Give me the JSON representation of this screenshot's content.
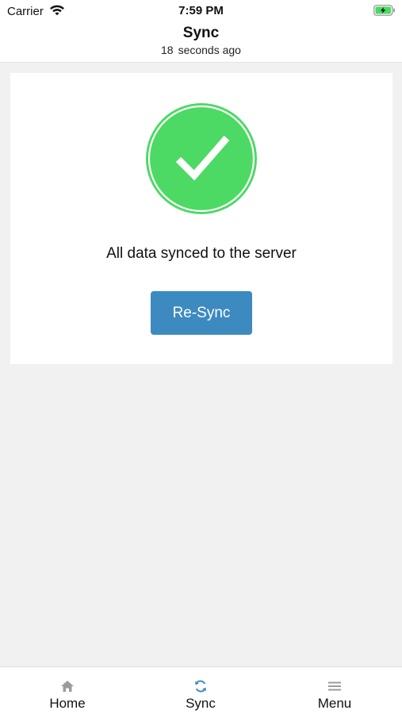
{
  "status_bar": {
    "carrier": "Carrier",
    "time": "7:59 PM",
    "icons": [
      "wifi-icon",
      "battery-charging-icon"
    ],
    "battery_color": "#4cd964"
  },
  "header": {
    "title": "Sync",
    "subtitle_value": "18",
    "subtitle_unit": "seconds ago"
  },
  "card": {
    "icon": "checkmark-circle-icon",
    "icon_color": "#4cd964",
    "message": "All data synced to the server",
    "button_label": "Re-Sync",
    "button_color": "#3d8ac0"
  },
  "tab_bar": {
    "active_color": "#3d8ac0",
    "inactive_icon_color": "#9b9b9b",
    "tabs": [
      {
        "label": "Home",
        "icon": "home-icon",
        "active": false
      },
      {
        "label": "Sync",
        "icon": "sync-icon",
        "active": true
      },
      {
        "label": "Menu",
        "icon": "hamburger-menu-icon",
        "active": false
      }
    ]
  }
}
